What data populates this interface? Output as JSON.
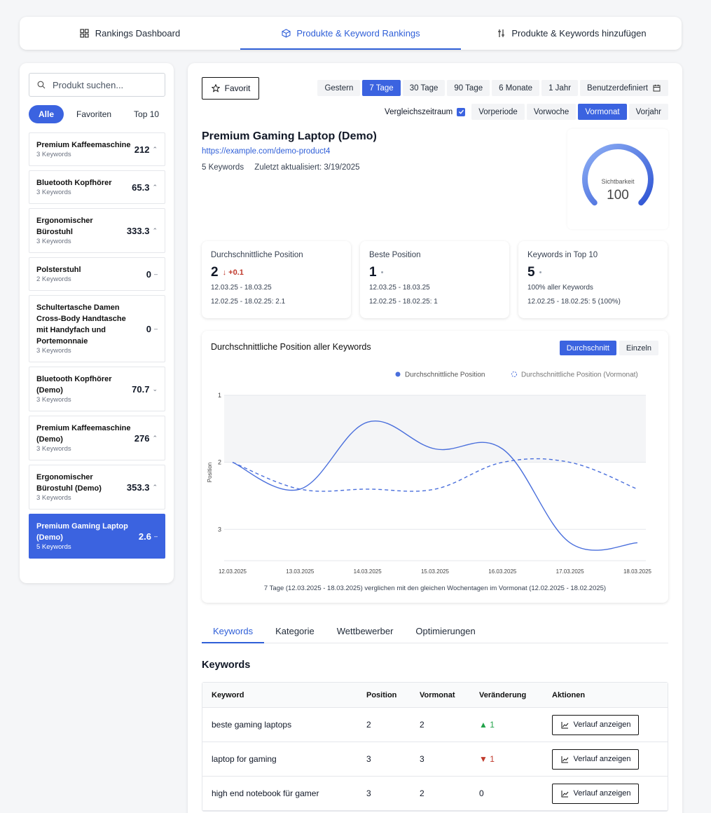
{
  "topnav": [
    {
      "label": "Rankings Dashboard",
      "icon": "grid-icon",
      "active": false
    },
    {
      "label": "Produkte & Keyword Rankings",
      "icon": "box-icon",
      "active": true
    },
    {
      "label": "Produkte & Keywords hinzufügen",
      "icon": "sliders-icon",
      "active": false
    }
  ],
  "sidebar": {
    "search_placeholder": "Produkt suchen...",
    "filters": [
      "Alle",
      "Favoriten",
      "Top 10"
    ],
    "active_filter": "Alle",
    "products": [
      {
        "name": "Premium Kaffeemaschine",
        "keywords": "3 Keywords",
        "value": "212",
        "trend": "up"
      },
      {
        "name": "Bluetooth Kopfhörer",
        "keywords": "3 Keywords",
        "value": "65.3",
        "trend": "up"
      },
      {
        "name": "Ergonomischer Bürostuhl",
        "keywords": "3 Keywords",
        "value": "333.3",
        "trend": "up"
      },
      {
        "name": "Polsterstuhl",
        "keywords": "2 Keywords",
        "value": "0",
        "trend": "flat"
      },
      {
        "name": "Schultertasche Damen Cross-Body Handtasche mit Handyfach und Portemonnaie",
        "keywords": "3 Keywords",
        "value": "0",
        "trend": "flat"
      },
      {
        "name": "Bluetooth Kopfhörer (Demo)",
        "keywords": "3 Keywords",
        "value": "70.7",
        "trend": "down"
      },
      {
        "name": "Premium Kaffeemaschine (Demo)",
        "keywords": "3 Keywords",
        "value": "276",
        "trend": "up"
      },
      {
        "name": "Ergonomischer Bürostuhl (Demo)",
        "keywords": "3 Keywords",
        "value": "353.3",
        "trend": "up"
      },
      {
        "name": "Premium Gaming Laptop (Demo)",
        "keywords": "5 Keywords",
        "value": "2.6",
        "trend": "flat",
        "active": true
      }
    ]
  },
  "main": {
    "favorite_label": "Favorit",
    "periods": [
      "Gestern",
      "7 Tage",
      "30 Tage",
      "90 Tage",
      "6 Monate",
      "1 Jahr",
      "Benutzerdefiniert"
    ],
    "active_period": "7 Tage",
    "compare_label": "Vergleichszeitraum",
    "compare_options": [
      "Vorperiode",
      "Vorwoche",
      "Vormonat",
      "Vorjahr"
    ],
    "active_compare": "Vormonat",
    "product_title": "Premium Gaming Laptop (Demo)",
    "product_url": "https://example.com/demo-product4",
    "keyword_count": "5 Keywords",
    "last_updated": "Zuletzt aktualisiert: 3/19/2025",
    "gauge": {
      "label": "Sichtbarkeit",
      "value": "100",
      "fraction": 1.0
    },
    "kpis": [
      {
        "title": "Durchschnittliche Position",
        "value": "2",
        "delta": "+0.1",
        "line1": "12.03.25 - 18.03.25",
        "line2": "12.02.25 - 18.02.25: 2.1"
      },
      {
        "title": "Beste Position",
        "value": "1",
        "delta": "•",
        "line1": "12.03.25 - 18.03.25",
        "line2": "12.02.25 - 18.02.25: 1"
      },
      {
        "title": "Keywords in Top 10",
        "value": "5",
        "delta": "•",
        "line1": "100% aller Keywords",
        "line2": "12.02.25 - 18.02.25: 5 (100%)"
      }
    ],
    "chart": {
      "title": "Durchschnittliche Position aller Keywords",
      "toggle": [
        "Durchschnitt",
        "Einzeln"
      ],
      "active_toggle": "Durchschnitt",
      "footer": "7 Tage (12.03.2025 - 18.03.2025) verglichen mit den gleichen Wochentagen im Vormonat (12.02.2025 - 18.02.2025)",
      "accent": "#4a6fdc"
    },
    "tabs": [
      "Keywords",
      "Kategorie",
      "Wettbewerber",
      "Optimierungen"
    ],
    "active_tab": "Keywords",
    "keywords_title": "Keywords",
    "table": {
      "headers": [
        "Keyword",
        "Position",
        "Vormonat",
        "Veränderung",
        "Aktionen"
      ],
      "rows": [
        {
          "keyword": "beste gaming laptops",
          "position": "2",
          "previous": "2",
          "change": "1",
          "direction": "up"
        },
        {
          "keyword": "laptop for gaming",
          "position": "3",
          "previous": "3",
          "change": "1",
          "direction": "down"
        },
        {
          "keyword": "high end notebook für gamer",
          "position": "3",
          "previous": "2",
          "change": "0",
          "direction": "flat"
        }
      ],
      "action_label": "Verlauf anzeigen"
    }
  },
  "chart_data": {
    "type": "line",
    "title": "Durchschnittliche Position aller Keywords",
    "x": [
      "12.03.2025",
      "13.03.2025",
      "14.03.2025",
      "15.03.2025",
      "16.03.2025",
      "17.03.2025",
      "18.03.2025"
    ],
    "series": [
      {
        "name": "Durchschnittliche Position",
        "values": [
          2.0,
          2.4,
          1.4,
          1.8,
          1.8,
          3.2,
          3.2
        ],
        "style": "solid"
      },
      {
        "name": "Durchschnittliche Position (Vormonat)",
        "values": [
          2.0,
          2.4,
          2.4,
          2.4,
          2.0,
          2.0,
          2.4
        ],
        "style": "dashed"
      }
    ],
    "y_ticks": [
      "1",
      "2",
      "3"
    ],
    "ylim": [
      1,
      3.3
    ],
    "y_inverted": true,
    "ylabel": "Position",
    "legend": "top-right",
    "grid": true
  }
}
